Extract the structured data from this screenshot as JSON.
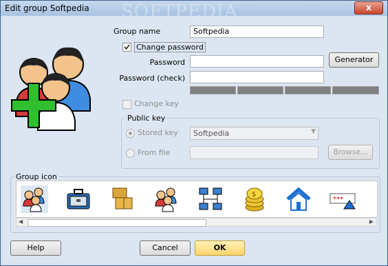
{
  "window": {
    "title": "Edit group Softpedia",
    "watermark": "SOFTPEDIA",
    "close_label": "x"
  },
  "form": {
    "group_name_label": "Group name",
    "group_name_value": "Softpedia",
    "change_password_label": "Change password",
    "change_password_checked": true,
    "password_label": "Password",
    "password_value": "",
    "password_check_label": "Password (check)",
    "password_check_value": "",
    "generator_label": "Generator",
    "change_key_label": "Change key",
    "change_key_checked": false
  },
  "public_key": {
    "title": "Public key",
    "stored_key_label": "Stored key",
    "stored_key_value": "Softpedia",
    "from_file_label": "From file",
    "from_file_value": "",
    "browse_label": "Browse..."
  },
  "group_icon": {
    "title": "Group icon",
    "icons": [
      "users-group-add-icon",
      "toolbox-icon",
      "boxes-icon",
      "users-group-icon",
      "network-icon",
      "coins-icon",
      "home-icon",
      "password-icon"
    ]
  },
  "buttons": {
    "help": "Help",
    "cancel": "Cancel",
    "ok": "OK"
  },
  "colors": {
    "ok_button": "#fcd46b",
    "accent": "#3a5f8a"
  }
}
